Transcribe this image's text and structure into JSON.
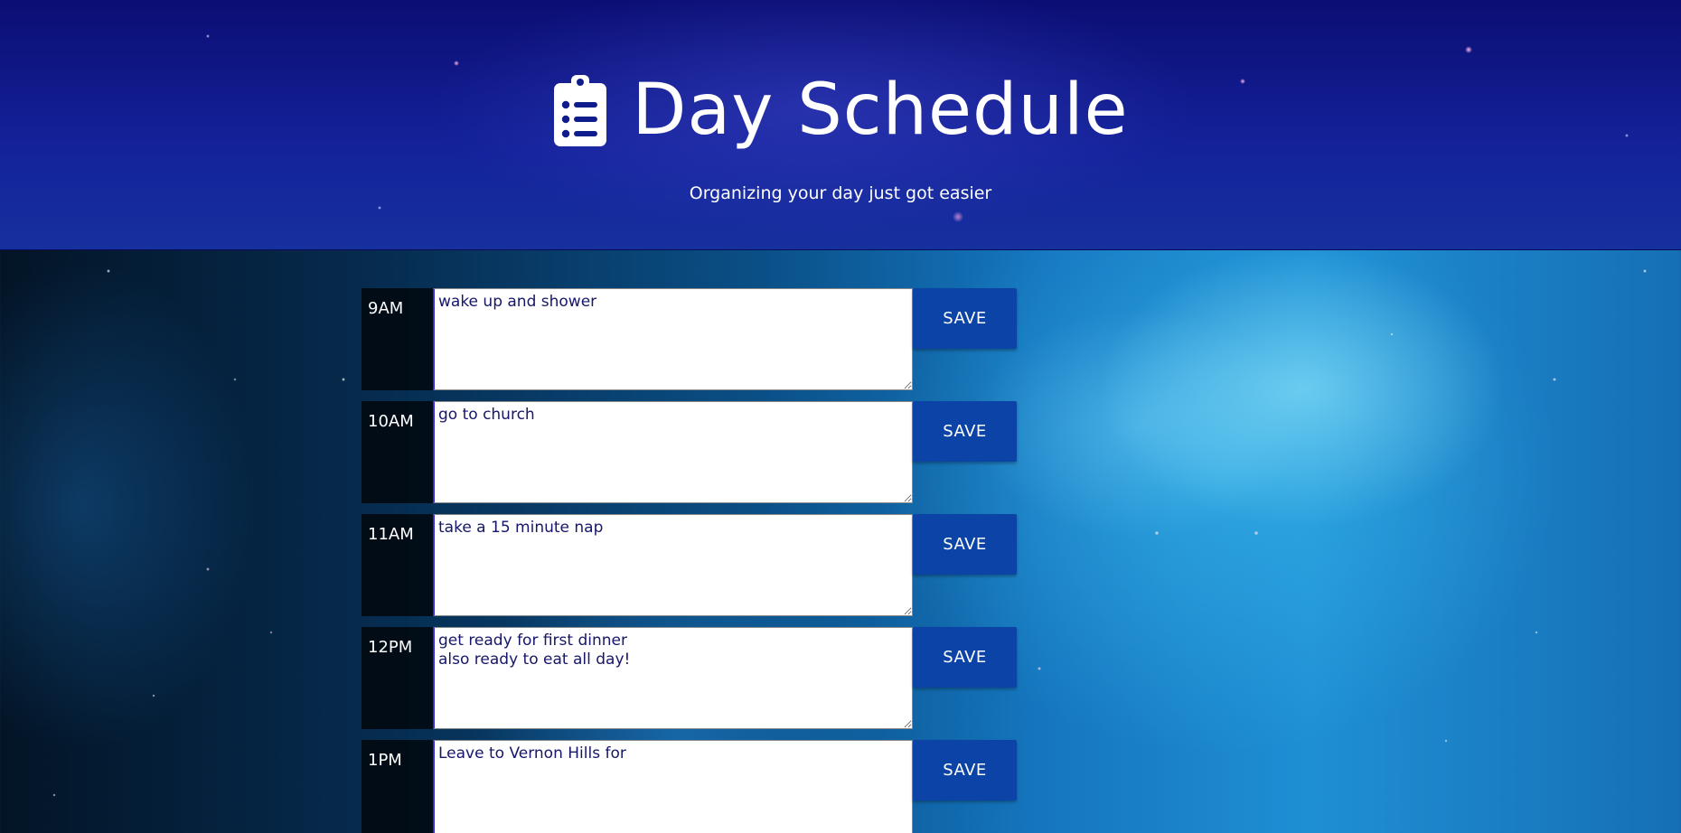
{
  "header": {
    "title": "Day Schedule",
    "subtitle": "Organizing your day just got easier",
    "icon": "clipboard-list-icon"
  },
  "colors": {
    "header_bg": "#0b0e74",
    "save_button": "#0b44a6",
    "text_accent": "#16166a",
    "hour_bg": "#000000"
  },
  "schedule": [
    {
      "hour": "9AM",
      "text": "wake up and shower",
      "save_label": "SAVE"
    },
    {
      "hour": "10AM",
      "text": "go to church",
      "save_label": "SAVE"
    },
    {
      "hour": "11AM",
      "text": "take a 15 minute nap",
      "save_label": "SAVE"
    },
    {
      "hour": "12PM",
      "text": "get ready for first dinner\nalso ready to eat all day!",
      "save_label": "SAVE"
    },
    {
      "hour": "1PM",
      "text": "Leave to Vernon Hills for",
      "save_label": "SAVE"
    }
  ]
}
